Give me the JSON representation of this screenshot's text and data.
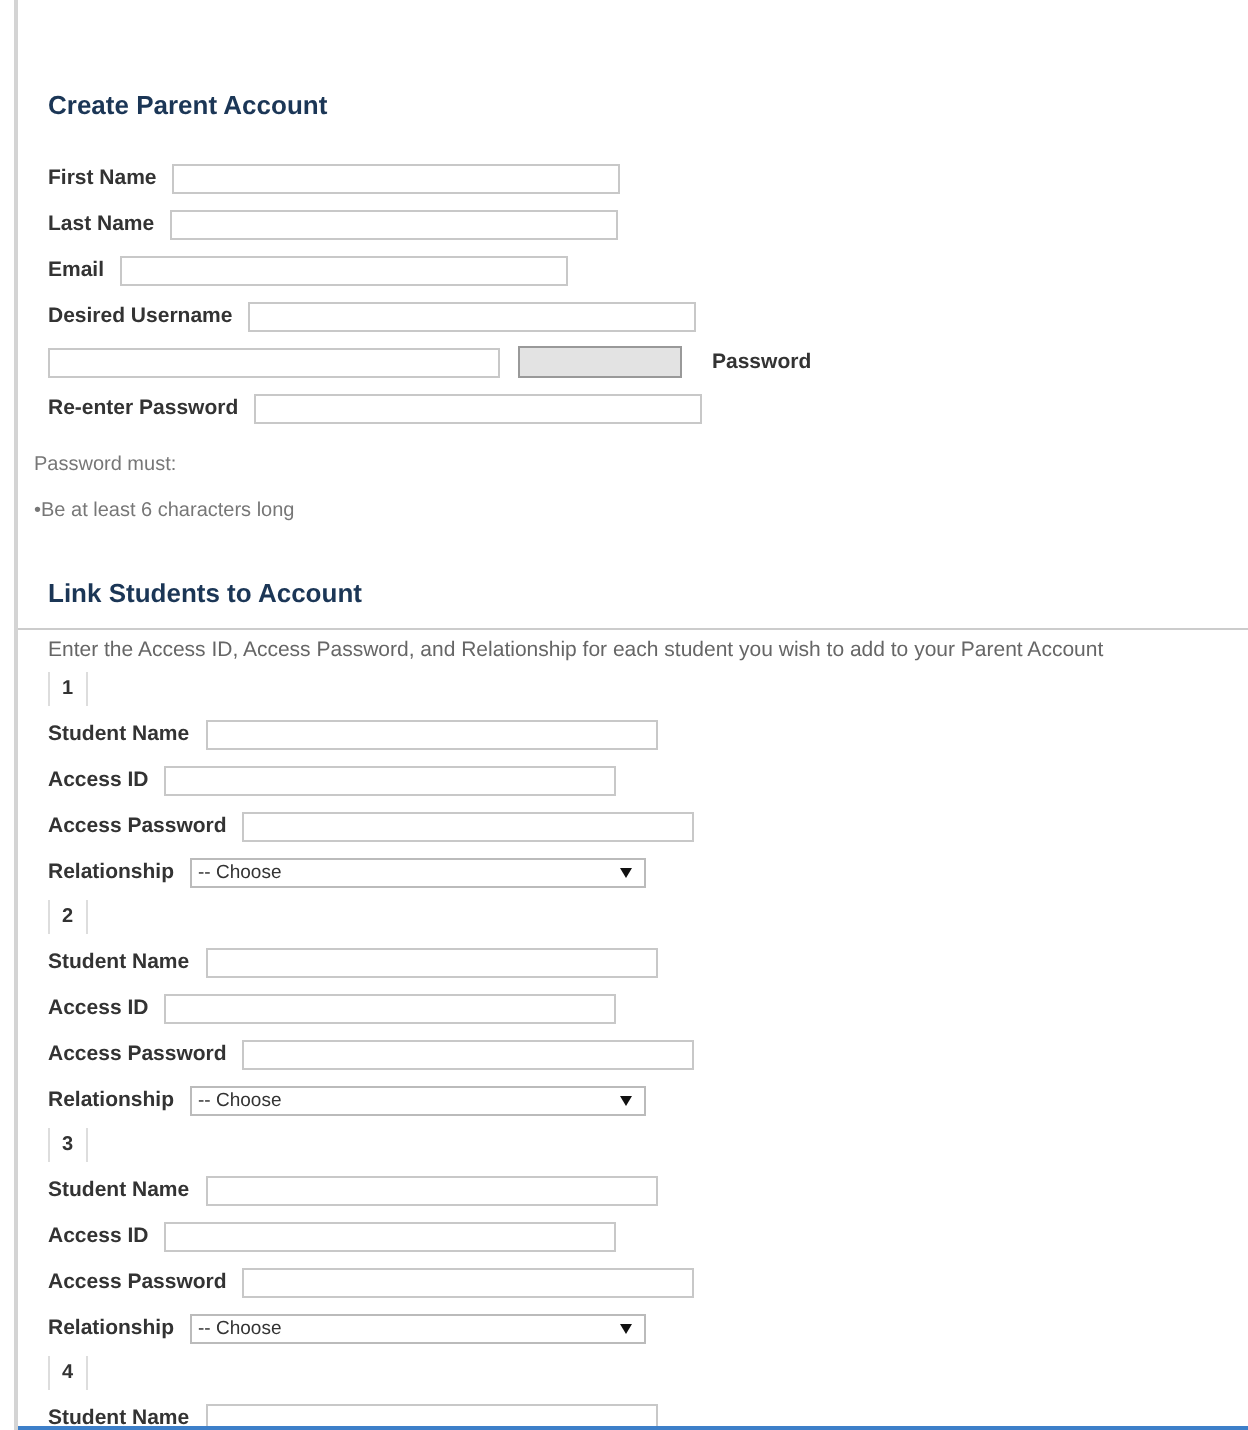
{
  "parent_account": {
    "title": "Create Parent Account",
    "fields": [
      {
        "kind": "text",
        "label": "First Name"
      },
      {
        "kind": "text",
        "label": "Last Name"
      },
      {
        "kind": "text",
        "label": "Email"
      },
      {
        "kind": "text",
        "label": "Desired Username"
      },
      {
        "kind": "password",
        "label": "Password"
      },
      {
        "kind": "text",
        "label": "Re-enter Password"
      }
    ],
    "rules_title": "Password must:",
    "rules": [
      "•Be at least 6 characters long"
    ]
  },
  "link_students": {
    "title": "Link Students to Account",
    "instructions": "Enter the Access ID, Access Password, and Relationship for each student you wish to add to your Parent Account",
    "students": [
      {
        "number": "1",
        "fields": [
          {
            "kind": "text",
            "label": "Student Name"
          },
          {
            "kind": "text",
            "label": "Access ID"
          },
          {
            "kind": "text",
            "label": "Access Password"
          },
          {
            "kind": "select",
            "label": "Relationship",
            "value": "-- Choose"
          }
        ]
      },
      {
        "number": "2",
        "fields": [
          {
            "kind": "text",
            "label": "Student Name"
          },
          {
            "kind": "text",
            "label": "Access ID"
          },
          {
            "kind": "text",
            "label": "Access Password"
          },
          {
            "kind": "select",
            "label": "Relationship",
            "value": "-- Choose"
          }
        ]
      },
      {
        "number": "3",
        "fields": [
          {
            "kind": "text",
            "label": "Student Name"
          },
          {
            "kind": "text",
            "label": "Access ID"
          },
          {
            "kind": "text",
            "label": "Access Password"
          },
          {
            "kind": "select",
            "label": "Relationship",
            "value": "-- Choose"
          }
        ]
      },
      {
        "number": "4",
        "fields": [
          {
            "kind": "text",
            "label": "Student Name"
          }
        ]
      }
    ]
  }
}
